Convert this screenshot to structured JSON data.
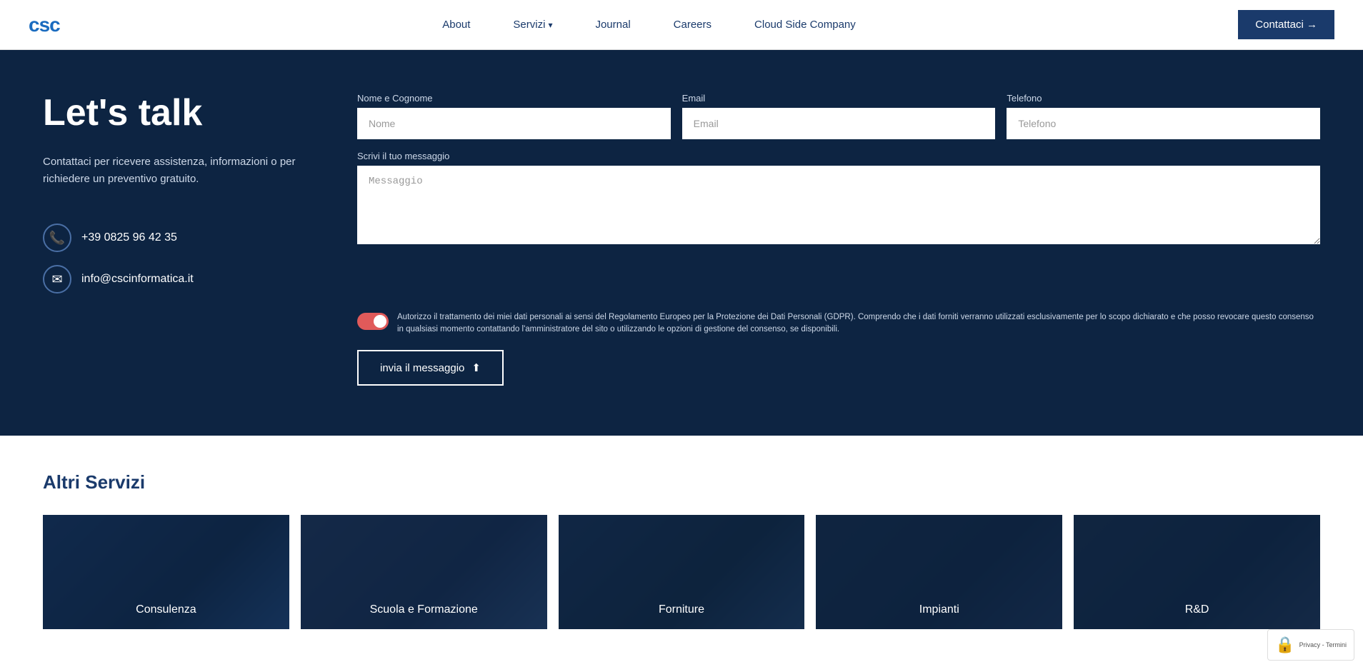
{
  "header": {
    "logo_text": "csc",
    "nav_items": [
      {
        "label": "About",
        "has_dropdown": false
      },
      {
        "label": "Servizi",
        "has_dropdown": true
      },
      {
        "label": "Journal",
        "has_dropdown": false
      },
      {
        "label": "Careers",
        "has_dropdown": false
      },
      {
        "label": "Cloud Side Company",
        "has_dropdown": false
      }
    ],
    "cta_button": "Contattaci →"
  },
  "contact": {
    "heading": "Let's talk",
    "description": "Contattaci per ricevere assistenza,\ninformazioni o per richiedere un preventivo\ngratuito.",
    "phone": "+39 0825 96 42 35",
    "email": "info@cscinformatica.it",
    "form": {
      "name_label": "Nome e Cognome",
      "name_placeholder": "Nome",
      "email_label": "Email",
      "email_placeholder": "Email",
      "phone_label": "Telefono",
      "phone_placeholder": "Telefono",
      "message_label": "Scrivi il tuo messaggio",
      "message_placeholder": "Messaggio",
      "gdpr_text": "Autorizzo il trattamento dei miei dati personali ai sensi del Regolamento Europeo per la Protezione dei Dati Personali (GDPR). Comprendo che i dati forniti verranno utilizzati esclusivamente per lo scopo dichiarato e che posso revocare questo consenso in qualsiasi momento contattando l'amministratore del sito o utilizzando le opzioni di gestione del consenso, se disponibili.",
      "submit_label": "invia il messaggio"
    }
  },
  "services": {
    "section_title": "Altri Servizi",
    "cards": [
      {
        "label": "Consulenza",
        "class": "card-consulenza"
      },
      {
        "label": "Scuola e Formazione",
        "class": "card-scuola"
      },
      {
        "label": "Forniture",
        "class": "card-forniture"
      },
      {
        "label": "Impianti",
        "class": "card-impianti"
      },
      {
        "label": "R&D",
        "class": "card-rd"
      }
    ]
  },
  "recaptcha": {
    "text": "Privacy - Termini"
  }
}
